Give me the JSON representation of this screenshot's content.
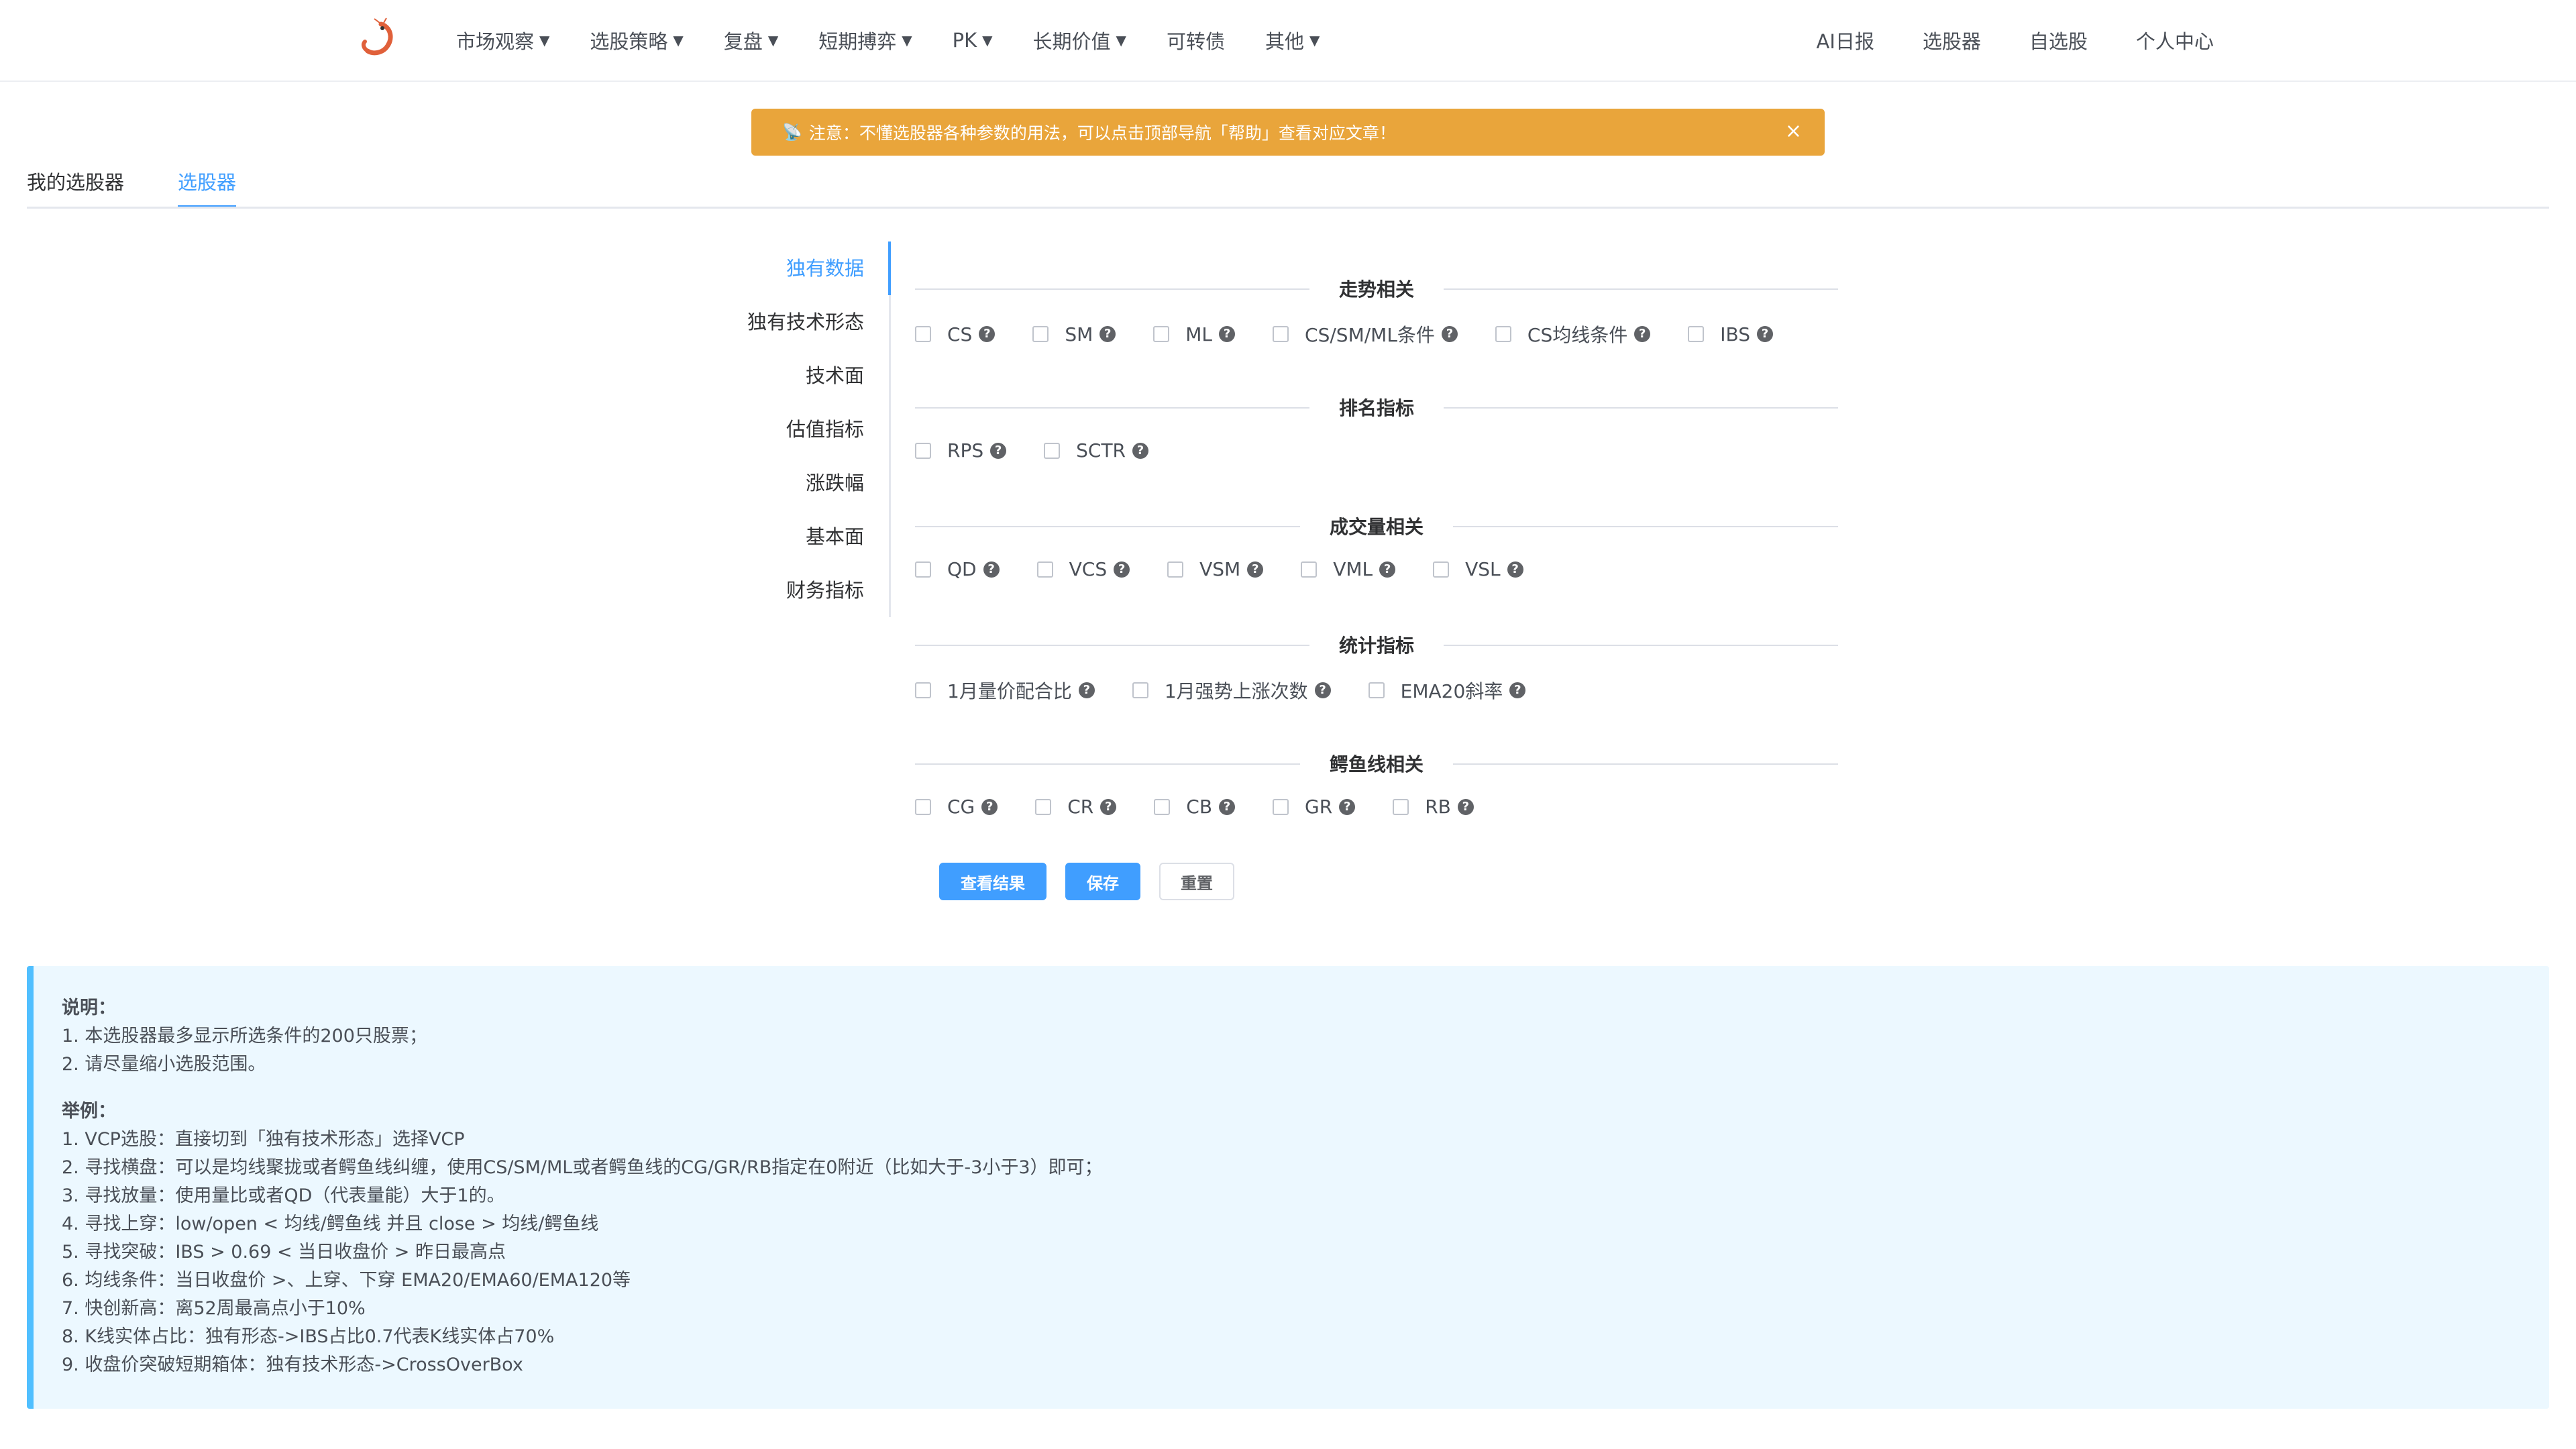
{
  "nav": {
    "menu": [
      {
        "label": "市场观察",
        "caret": true
      },
      {
        "label": "选股策略",
        "caret": true
      },
      {
        "label": "复盘",
        "caret": true
      },
      {
        "label": "短期搏弈",
        "caret": true
      },
      {
        "label": "PK",
        "caret": true
      },
      {
        "label": "长期价值",
        "caret": true
      },
      {
        "label": "可转债",
        "caret": false
      },
      {
        "label": "其他",
        "caret": true
      }
    ],
    "right": [
      "AI日报",
      "选股器",
      "自选股",
      "个人中心"
    ]
  },
  "notice": {
    "text": "注意：不懂选股器各种参数的用法，可以点击顶部导航「帮助」查看对应文章！",
    "close": "×",
    "accent": "#e9a53b"
  },
  "tabs": [
    "我的选股器",
    "选股器"
  ],
  "side_tabs": [
    "独有数据",
    "独有技术形态",
    "技术面",
    "估值指标",
    "涨跌幅",
    "基本面",
    "财务指标"
  ],
  "sections": [
    {
      "title": "走势相关",
      "items": [
        "CS",
        "SM",
        "ML",
        "CS/SM/ML条件",
        "CS均线条件",
        "IBS"
      ]
    },
    {
      "title": "排名指标",
      "items": [
        "RPS",
        "SCTR"
      ]
    },
    {
      "title": "成交量相关",
      "items": [
        "QD",
        "VCS",
        "VSM",
        "VML",
        "VSL"
      ]
    },
    {
      "title": "统计指标",
      "items": [
        "1月量价配合比",
        "1月强势上涨次数",
        "EMA20斜率"
      ]
    },
    {
      "title": "鳄鱼线相关",
      "items": [
        "CG",
        "CR",
        "CB",
        "GR",
        "RB"
      ]
    }
  ],
  "buttons": {
    "view": "查看结果",
    "save": "保存",
    "reset": "重置"
  },
  "info": {
    "desc_title": "说明：",
    "desc": [
      "1. 本选股器最多显示所选条件的200只股票；",
      "2. 请尽量缩小选股范围。"
    ],
    "example_title": "举例：",
    "examples": [
      "1. VCP选股：直接切到「独有技术形态」选择VCP",
      "2. 寻找横盘：可以是均线聚拢或者鳄鱼线纠缠，使用CS/SM/ML或者鳄鱼线的CG/GR/RB指定在0附近（比如大于-3小于3）即可；",
      "3. 寻找放量：使用量比或者QD（代表量能）大于1的。",
      "4. 寻找上穿：low/open < 均线/鳄鱼线 并且 close > 均线/鳄鱼线",
      "5. 寻找突破：IBS > 0.69 < 当日收盘价 > 昨日最高点",
      "6. 均线条件：当日收盘价 >、上穿、下穿 EMA20/EMA60/EMA120等",
      "7. 快创新高：离52周最高点小于10%",
      "8. K线实体占比：独有形态->IBS占比0.7代表K线实体占70%",
      "9. 收盘价突破短期箱体：独有技术形态->CrossOverBox"
    ]
  },
  "colors": {
    "primary": "#409eff",
    "info_bg": "#ecf8ff",
    "info_border": "#50bfff"
  }
}
